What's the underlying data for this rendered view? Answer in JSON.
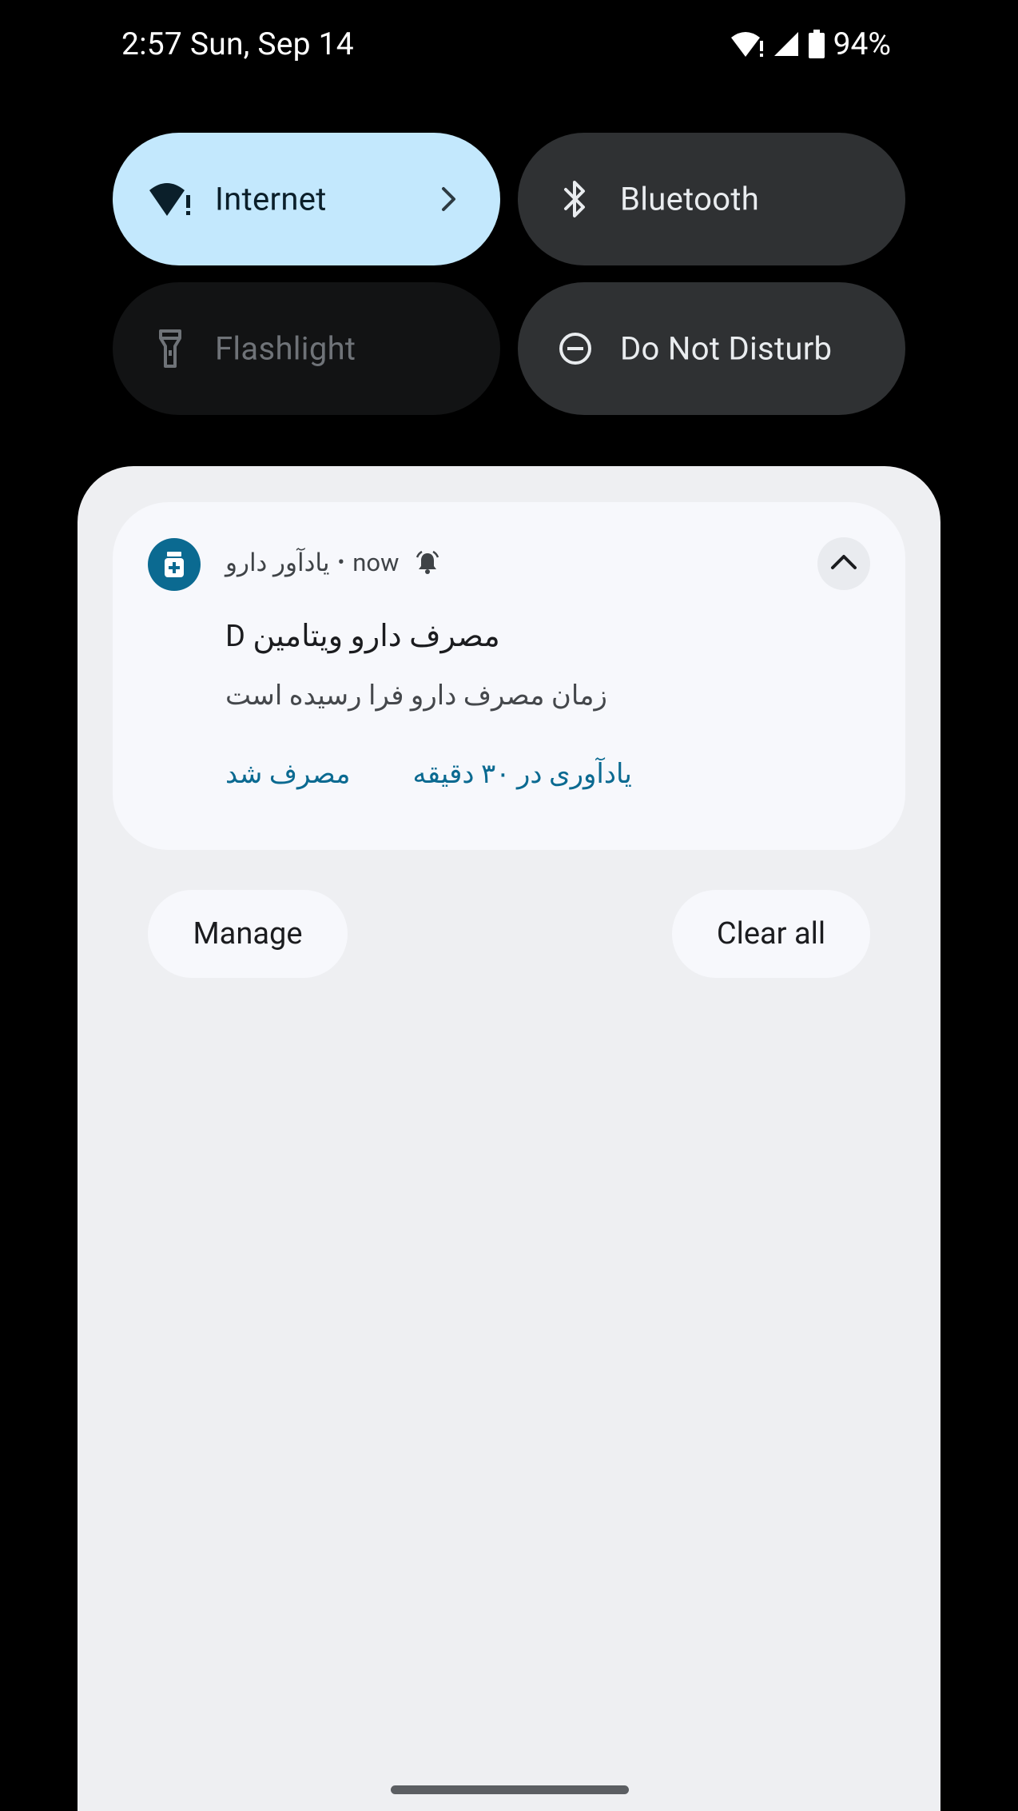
{
  "status_bar": {
    "time": "2:57",
    "date": "Sun, Sep 14",
    "battery": "94%",
    "icons": [
      "wifi-alert-icon",
      "cellular-signal-icon",
      "battery-icon"
    ]
  },
  "quick_settings": {
    "internet": {
      "label": "Internet",
      "icon": "wifi-alert-icon",
      "state": "on"
    },
    "bluetooth": {
      "label": "Bluetooth",
      "icon": "bluetooth-icon",
      "state": "off"
    },
    "flashlight": {
      "label": "Flashlight",
      "icon": "flashlight-icon",
      "state": "unavailable"
    },
    "dnd": {
      "label": "Do Not Disturb",
      "icon": "do-not-disturb-icon",
      "state": "off"
    }
  },
  "notification": {
    "app_name": "یادآور دارو",
    "separator": "•",
    "time": "now",
    "title": "مصرف دارو ویتامین D",
    "body": "زمان مصرف دارو فرا رسیده است",
    "actions": [
      "مصرف شد",
      "یادآوری در ۳۰ دقیقه"
    ],
    "accent_color": "#0b6a91"
  },
  "shade_buttons": {
    "manage": "Manage",
    "clear_all": "Clear all"
  }
}
